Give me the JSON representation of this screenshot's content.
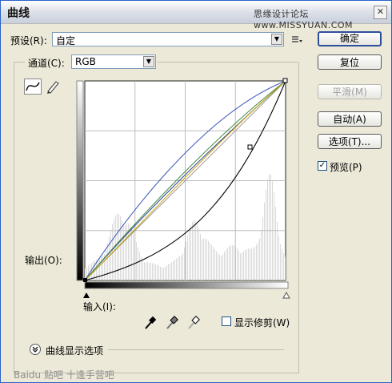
{
  "window": {
    "title": "曲线",
    "watermark": "思缘设计论坛 www.MISSYUAN.COM",
    "close_glyph": "✕"
  },
  "preset": {
    "label": "预设(R):",
    "value": "自定",
    "menu_icon": "preset-menu-icon"
  },
  "channel": {
    "label": "通道(C):",
    "value": "RGB"
  },
  "graph": {
    "output_label": "输出(O):",
    "input_label": "输入(I):",
    "tool_icons": [
      "curve-tool-icon",
      "pencil-tool-icon"
    ]
  },
  "eyedroppers": [
    "black-point-eyedropper-icon",
    "gray-point-eyedropper-icon",
    "white-point-eyedropper-icon"
  ],
  "clipping": {
    "label": "显示修剪(W)",
    "checked": false
  },
  "display_options": {
    "label": "曲线显示选项"
  },
  "buttons": {
    "ok": "确定",
    "reset": "复位",
    "smooth": "平滑(M)",
    "auto": "自动(A)",
    "options": "选项(T)..."
  },
  "preview": {
    "label": "预览(P)",
    "checked": true,
    "check_glyph": "✓"
  },
  "footer_watermark": "Baidu 贴吧 十逢手营吧"
}
